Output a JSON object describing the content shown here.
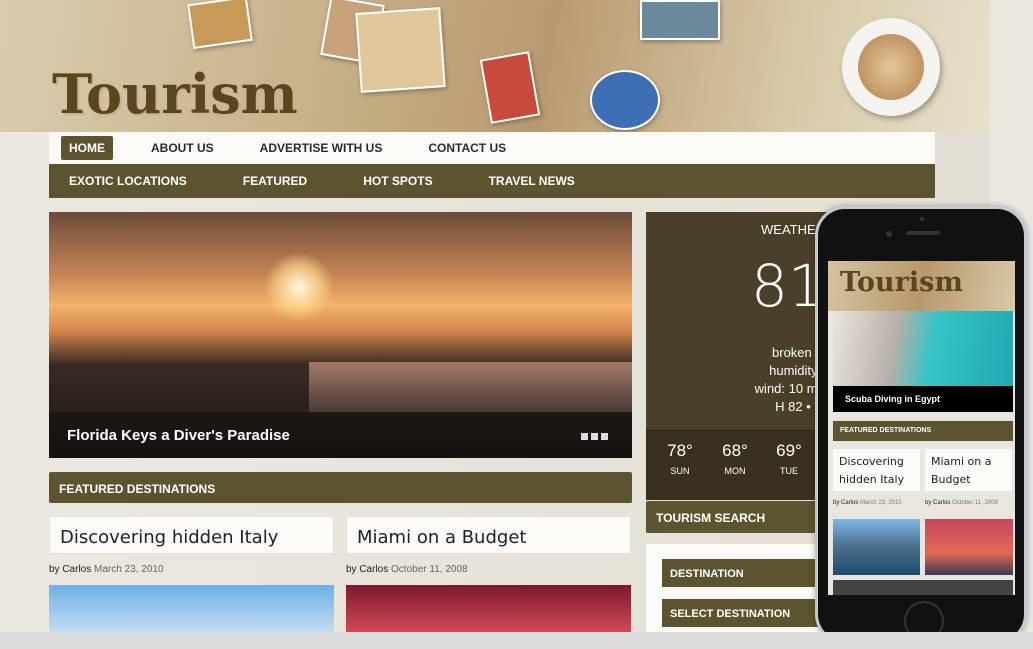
{
  "header": {
    "logo": "Tourism"
  },
  "nav_primary": [
    {
      "label": "HOME",
      "active": true
    },
    {
      "label": "ABOUT US"
    },
    {
      "label": "ADVERTISE WITH US"
    },
    {
      "label": "CONTACT US"
    }
  ],
  "nav_secondary": [
    {
      "label": "EXOTIC LOCATIONS"
    },
    {
      "label": "FEATURED"
    },
    {
      "label": "HOT SPOTS"
    },
    {
      "label": "TRAVEL NEWS"
    }
  ],
  "hero": {
    "caption": "Florida Keys a Diver's Paradise",
    "slides": 3
  },
  "featured": {
    "title": "FEATURED DESTINATIONS",
    "posts": [
      {
        "title": "Discovering hidden Italy",
        "author": "by Carlos",
        "date": "March 23, 2010"
      },
      {
        "title": "Miami on a Budget",
        "author": "by Carlos",
        "date": "October 11, 2008"
      }
    ]
  },
  "weather": {
    "title": "WEATHER",
    "temp": "81",
    "condition": "broken clo",
    "humidity": "humidity: 6",
    "wind": "wind: 10 mph",
    "hilo": "H 82 • L 7",
    "forecast": [
      {
        "temp": "78°",
        "day": "SUN"
      },
      {
        "temp": "68°",
        "day": "MON"
      },
      {
        "temp": "69°",
        "day": "TUE"
      }
    ]
  },
  "search": {
    "title": "TOURISM SEARCH",
    "destination_label": "DESTINATION",
    "select_label": "SELECT DESTINATION"
  },
  "phone": {
    "logo": "Tourism",
    "hero_caption": "Scuba Diving in Egypt",
    "section_title": "FEATURED DESTINATIONS",
    "posts": [
      {
        "title": "Discovering hidden Italy",
        "author": "by Carlos",
        "date": "March 23, 2010"
      },
      {
        "title": "Miami on a Budget",
        "author": "by Carlos",
        "date": "October 11, 2008"
      }
    ]
  },
  "colors": {
    "accent": "#5c5431",
    "weather_bg": "#4a3f28"
  }
}
